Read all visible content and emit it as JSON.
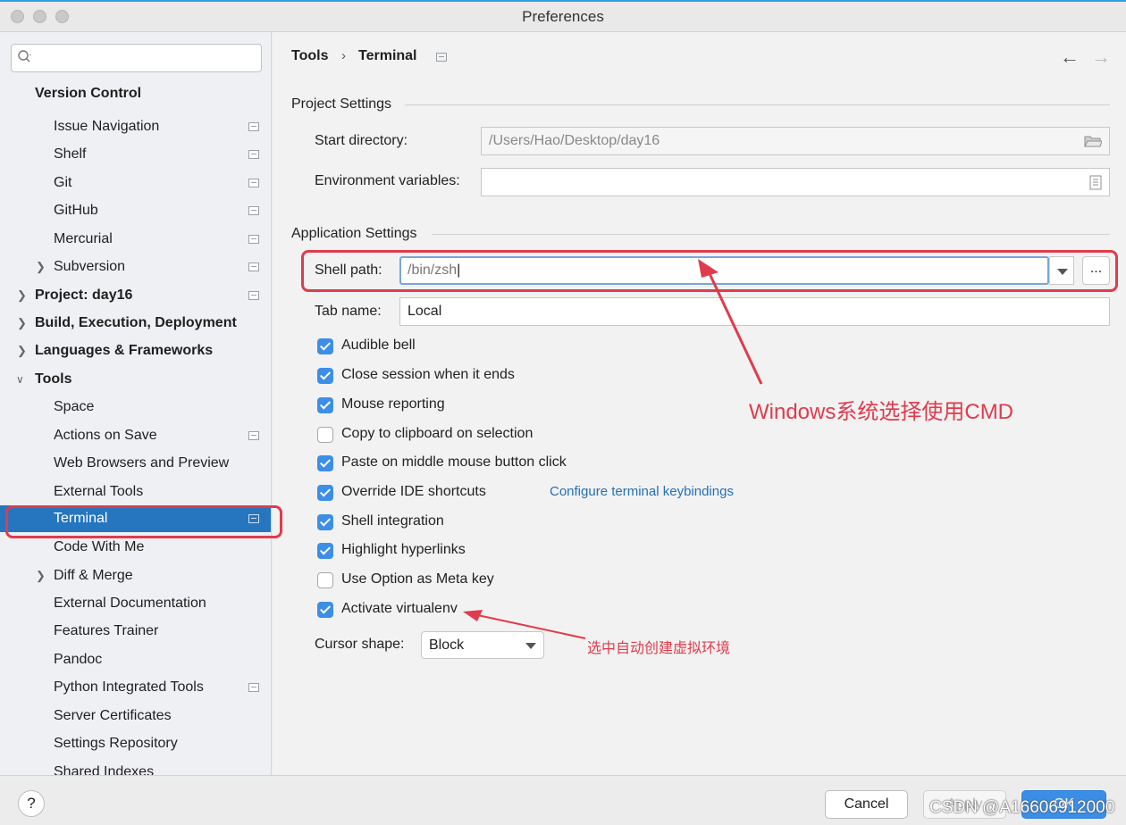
{
  "window": {
    "title": "Preferences"
  },
  "sidebar": {
    "search_placeholder": "",
    "items": [
      {
        "label": "Version Control",
        "bold": true
      },
      {
        "label": "Issue Navigation"
      },
      {
        "label": "Shelf"
      },
      {
        "label": "Git"
      },
      {
        "label": "GitHub"
      },
      {
        "label": "Mercurial"
      },
      {
        "label": "Subversion"
      },
      {
        "label": "Project: day16",
        "bold": true
      },
      {
        "label": "Build, Execution, Deployment",
        "bold": true
      },
      {
        "label": "Languages & Frameworks",
        "bold": true
      },
      {
        "label": "Tools",
        "bold": true
      },
      {
        "label": "Space"
      },
      {
        "label": "Actions on Save"
      },
      {
        "label": "Web Browsers and Preview"
      },
      {
        "label": "External Tools"
      },
      {
        "label": "Terminal",
        "selected": true
      },
      {
        "label": "Code With Me"
      },
      {
        "label": "Diff & Merge"
      },
      {
        "label": "External Documentation"
      },
      {
        "label": "Features Trainer"
      },
      {
        "label": "Pandoc"
      },
      {
        "label": "Python Integrated Tools"
      },
      {
        "label": "Server Certificates"
      },
      {
        "label": "Settings Repository"
      },
      {
        "label": "Shared Indexes"
      }
    ]
  },
  "header": {
    "crumb1": "Tools",
    "separator": "›",
    "crumb2": "Terminal",
    "back": "←",
    "forward": "→"
  },
  "project_settings": {
    "title": "Project Settings",
    "start_dir_label": "Start directory:",
    "start_dir_value": "/Users/Hao/Desktop/day16",
    "env_label": "Environment variables:",
    "env_value": ""
  },
  "app_settings": {
    "title": "Application Settings",
    "shell_label": "Shell path:",
    "shell_value": "/bin/zsh",
    "browse": "...",
    "tab_label": "Tab name:",
    "tab_value": "Local",
    "checkboxes": [
      {
        "label": "Audible bell",
        "checked": true
      },
      {
        "label": "Close session when it ends",
        "checked": true
      },
      {
        "label": "Mouse reporting",
        "checked": true
      },
      {
        "label": "Copy to clipboard on selection",
        "checked": false
      },
      {
        "label": "Paste on middle mouse button click",
        "checked": true
      },
      {
        "label": "Override IDE shortcuts",
        "checked": true
      },
      {
        "label": "Shell integration",
        "checked": true
      },
      {
        "label": "Highlight hyperlinks",
        "checked": true
      },
      {
        "label": "Use Option as Meta key",
        "checked": false
      },
      {
        "label": "Activate virtualenv",
        "checked": true
      }
    ],
    "keybindings_link": "Configure terminal keybindings",
    "cursor_label": "Cursor shape:",
    "cursor_value": "Block"
  },
  "annotations": {
    "windows_note": "Windows系统选择使用CMD",
    "virtualenv_note": "选中自动创建虚拟环境",
    "color": "#e03b4c"
  },
  "footer": {
    "help": "?",
    "cancel": "Cancel",
    "apply": "Apply",
    "ok": "OK",
    "watermark": "CSDN @A16606912000"
  }
}
